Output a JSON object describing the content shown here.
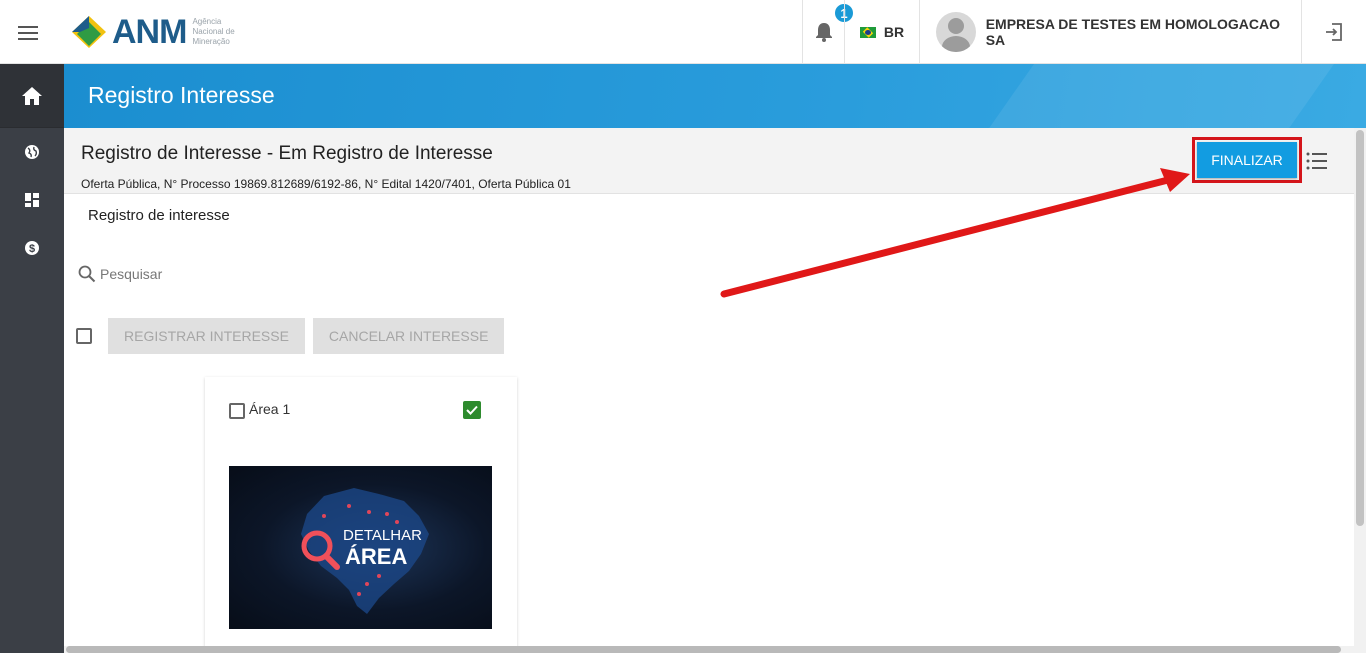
{
  "topbar": {
    "logo_text": "ANM",
    "logo_subtitle": "Agência Nacional de Mineração",
    "notifications_count": "1",
    "language": "BR",
    "company": "EMPRESA DE TESTES EM HOMOLOGACAO SA"
  },
  "sidebar": {
    "items": [
      {
        "icon": "home-icon"
      },
      {
        "icon": "globe-icon"
      },
      {
        "icon": "dashboard-icon"
      },
      {
        "icon": "money-icon"
      }
    ]
  },
  "header": {
    "title": "Registro Interesse"
  },
  "subheader": {
    "title": "Registro de Interesse - Em Registro de Interesse",
    "meta": "Oferta Pública, N° Processo 19869.812689/6192-86, N° Edital 1420/7401, Oferta Pública 01",
    "finalize_label": "FINALIZAR"
  },
  "main": {
    "section_label": "Registro de interesse",
    "search_placeholder": "Pesquisar",
    "register_label": "REGISTRAR INTERESSE",
    "cancel_label": "CANCELAR INTERESSE"
  },
  "card": {
    "title": "Área 1",
    "image_line1": "DETALHAR",
    "image_line2": "ÁREA"
  },
  "colors": {
    "accent": "#129ce1",
    "header_band": "#1b8ed0",
    "sidebar": "#3b3f46",
    "highlight": "#d4141a",
    "check_green": "#2e8b2e"
  }
}
